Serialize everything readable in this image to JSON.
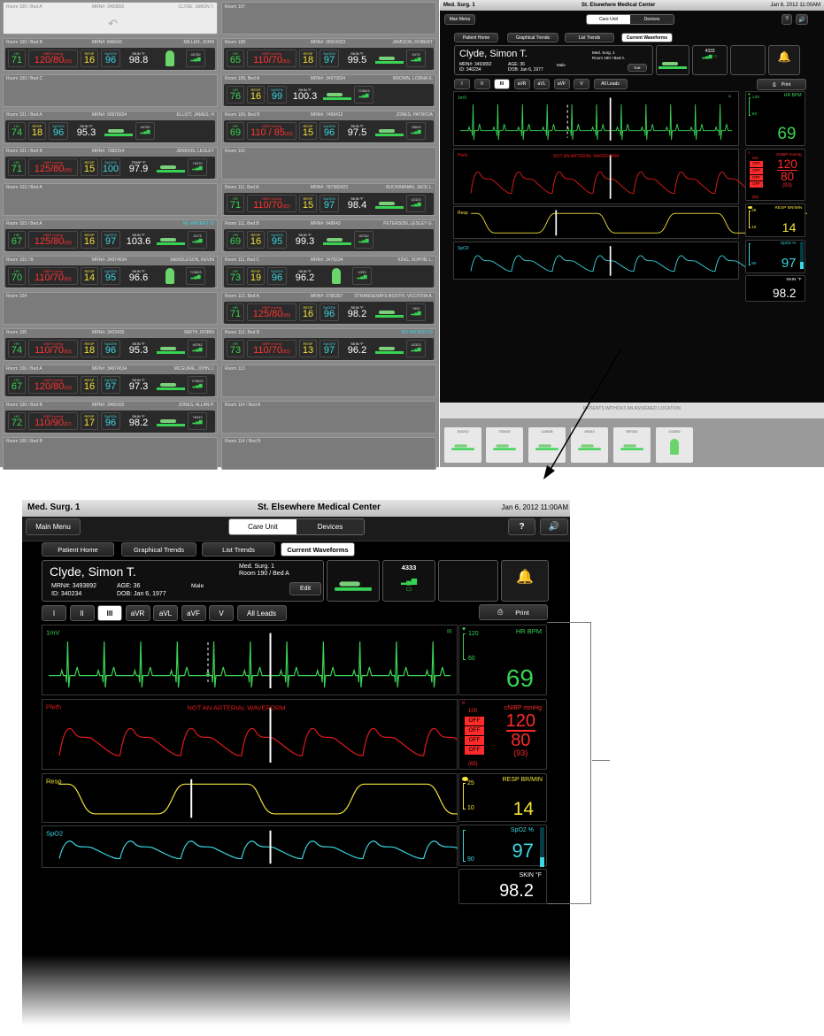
{
  "grid": {
    "left": [
      {
        "room": "Room 100 / Bed A",
        "mrn": "MRN#: 3493892",
        "name": "CLYDE, SIMON T.",
        "state": "selected"
      },
      {
        "room": "Room 100 / Bed B",
        "mrn": "MRN#: 846643",
        "name": "MILLER, JOHN",
        "hr": "71",
        "nibp": "120/80",
        "nibp_mean": "(93)",
        "resp": "16",
        "spo2": "96",
        "skin": "98.8",
        "icon": "person",
        "dev": "45782"
      },
      {
        "room": "Room 100 / Bed C",
        "state": "empty"
      },
      {
        "room": "Room 101 / Bed A",
        "mrn": "MRN#: 90978934",
        "name": "ELLIOT, JAMES. H",
        "hr": "74",
        "resp": "18",
        "spo2": "96",
        "skin": "95.3",
        "icon": "bed",
        "dev": "45782"
      },
      {
        "room": "Room 101 / Bed B",
        "mrn": "MRN#: 7382314",
        "name": "JENKINS, LESLEY",
        "hr": "71",
        "nibp": "125/80",
        "nibp_mean": "(95)",
        "resp": "15",
        "spo2": "100",
        "skin": "97.9",
        "skin_label": "TEMP °F",
        "icon": "bed",
        "dev": "78370"
      },
      {
        "room": "Room 103 / Bed A",
        "state": "empty"
      },
      {
        "room": "Room 103 / Bed A",
        "mrn": "",
        "name": "NO PATIENT ID",
        "hr": "67",
        "nibp": "125/80",
        "nibp_mean": "(95)",
        "resp": "16",
        "spo2": "97",
        "skin": "103.6",
        "icon": "bed",
        "dev": "5473"
      },
      {
        "room": "Room 103 / B",
        "mrn": "MRN#: 34974534",
        "name": "MENDLESON, KEVIN",
        "hr": "70",
        "nibp": "110/70",
        "nibp_mean": "(83)",
        "resp": "14",
        "spo2": "95",
        "skin": "96.6",
        "icon": "person",
        "dev": "723823"
      },
      {
        "room": "Room 104",
        "state": "empty"
      },
      {
        "room": "Room 105",
        "mrn": "MRN#: 3423435",
        "name": "SMITH, ROBIN",
        "hr": "74",
        "nibp": "110/70",
        "nibp_mean": "(83)",
        "resp": "18",
        "spo2": "96",
        "skin": "95.3",
        "icon": "bed",
        "dev": "45782"
      },
      {
        "room": "Room 106 / Bed A",
        "mrn": "MRN#: 34974534",
        "name": "MCGUIRE, JOHN J.",
        "hr": "67",
        "nibp": "120/80",
        "nibp_mean": "(93)",
        "resp": "16",
        "spo2": "97",
        "skin": "97.3",
        "icon": "bed",
        "dev": "723823"
      },
      {
        "room": "Room 106 / Bed B",
        "mrn": "MRN#: 3465432",
        "name": "JONES, ALLAN P.",
        "hr": "72",
        "nibp": "110/90",
        "nibp_mean": "(97)",
        "resp": "17",
        "spo2": "96",
        "skin": "98.2",
        "icon": "bed",
        "dev": "78949"
      },
      {
        "room": "Room 106 / Bed B",
        "state": "empty"
      }
    ],
    "right": [
      {
        "room": "Room 107",
        "state": "empty"
      },
      {
        "room": "Room 108",
        "mrn": "MRN#: 36554323",
        "name": "JAMISON, ROBERT",
        "hr": "65",
        "nibp": "110/70",
        "nibp_mean": "(83)",
        "resp": "18",
        "spo2": "97",
        "skin": "99.5",
        "icon": "bed",
        "dev": "5473"
      },
      {
        "room": "Room 108, Bed A",
        "mrn": "MRN#: 34976534",
        "name": "BROWN, LORNA S.",
        "hr": "76",
        "resp": "16",
        "spo2": "99",
        "skin": "100.3",
        "icon": "bed",
        "dev": "723823"
      },
      {
        "room": "Room 109, Bed B",
        "mrn": "MRN#: 7458412",
        "name": "JONES, PATRICIA",
        "hr": "69",
        "nibp": "110 / 85",
        "nibp_mean": "(93)",
        "resp": "15",
        "spo2": "96",
        "skin": "97.5",
        "icon": "bed",
        "dev": "78649"
      },
      {
        "room": "Room 110",
        "state": "empty"
      },
      {
        "room": "Room 111, Bed A",
        "mrn": "MRN#: 787382423",
        "name": "BUCHANNAN, JACK L.",
        "hr": "71",
        "nibp": "110/70",
        "nibp_mean": "(83)",
        "resp": "15",
        "spo2": "97",
        "skin": "98.4",
        "icon": "bed",
        "dev": "42323"
      },
      {
        "room": "Room 111, Bed B",
        "mrn": "MRN#: 648643",
        "name": "PETERSON, LESLEY G.",
        "hr": "69",
        "resp": "16",
        "spo2": "95",
        "skin": "99.3",
        "icon": "bed",
        "dev": "45782"
      },
      {
        "room": "Room 111, Bed C",
        "mrn": "MRN#: 3478234",
        "name": "KING, SOPHIE L.",
        "hr": "73",
        "resp": "19",
        "spo2": "96",
        "skin": "96.2",
        "icon": "person",
        "dev": "4333"
      },
      {
        "room": "Room 112, Bed A",
        "mrn": "MRN#: 9786357",
        "name": "STRANGENAYS-BOOTH, VICOTRIA A.",
        "hr": "71",
        "nibp": "125/80",
        "nibp_mean": "(95)",
        "resp": "16",
        "spo2": "96",
        "skin": "98.2",
        "icon": "bed",
        "dev": "7832"
      },
      {
        "room": "Room 112, Bed B",
        "mrn": "",
        "name": "NO PATIENT ID",
        "hr": "73",
        "nibp": "110/70",
        "nibp_mean": "(83)",
        "resp": "13",
        "spo2": "97",
        "skin": "96.2",
        "icon": "bed",
        "dev": "42323"
      },
      {
        "room": "Room 113",
        "state": "empty"
      },
      {
        "room": "Room 114 / Bed A",
        "state": "empty"
      },
      {
        "room": "Room 114 / Bed B",
        "state": "empty"
      }
    ]
  },
  "labels": {
    "hr": "HR",
    "nibp": "NIBP mmHg",
    "resp": "RESP",
    "spo2": "SpO2%",
    "skin": "SKIN °F"
  },
  "unassigned": {
    "label": "PATIENTS WITHOUT AN ASSIGNED LOCATION",
    "tiles": [
      "343242",
      "783432",
      "124635",
      "65343",
      "987342",
      "134352"
    ]
  },
  "monitor": {
    "unit": "Med. Surg. 1",
    "hospital": "St. Elsewhere Medical Center",
    "datetime": "Jan 6, 2012  11:00AM",
    "main_menu": "Main Menu",
    "small_main_menu": "Man Menu",
    "tab_care": "Care Unit",
    "tab_devices": "Devices",
    "help": "?",
    "subtabs": [
      "Patient Home",
      "Graphical Trends",
      "List Trends",
      "Current Waveforms"
    ],
    "patient": {
      "name": "Clyde, Simon T.",
      "mrn": "MRN#: 3493892",
      "id": "ID: 340234",
      "age": "AGE: 36",
      "dob": "DOB: Jan 6, 1977",
      "sex": "Male",
      "loc1": "Med. Surg. 1",
      "loc2": "Room 190 / Bed A",
      "edit": "Edit"
    },
    "device_id": "4333",
    "leads": [
      "I",
      "II",
      "III",
      "aVR",
      "aVL",
      "aVF",
      "V",
      "All Leads"
    ],
    "print": "Print",
    "waves": {
      "ecg_label": "1mV",
      "ecg_lead": "III",
      "pleth_label": "Pleth",
      "pleth_note": "NOT AN ARTERIAL WAVEFORM",
      "resp_label": "Resp",
      "spo2_label": "SpO2"
    },
    "vitals": {
      "hr_label": "HR BPM",
      "hr_value": "69",
      "hr_hi": "120",
      "hr_lo": "60",
      "nibp_label": "cNIBP mmHg",
      "nibp_sys": "120",
      "nibp_dia": "80",
      "nibp_mean": "(93)",
      "nibp_hi": "100",
      "nibp_off": "OFF",
      "nibp_lo": "(65)",
      "resp_label": "RESP BR/MIN",
      "resp_value": "14",
      "resp_hi": "25",
      "resp_lo": "10",
      "spo2_label": "SpO2 %",
      "spo2_value": "97",
      "spo2_lo": "90",
      "skin_label": "SKIN °F",
      "skin_value": "98.2"
    }
  },
  "colors": {
    "ecg": "#39d353",
    "pleth": "#e01b1b",
    "resp": "#f2e33a",
    "spo2": "#3bd7e3",
    "red": "#ff2a2a"
  }
}
